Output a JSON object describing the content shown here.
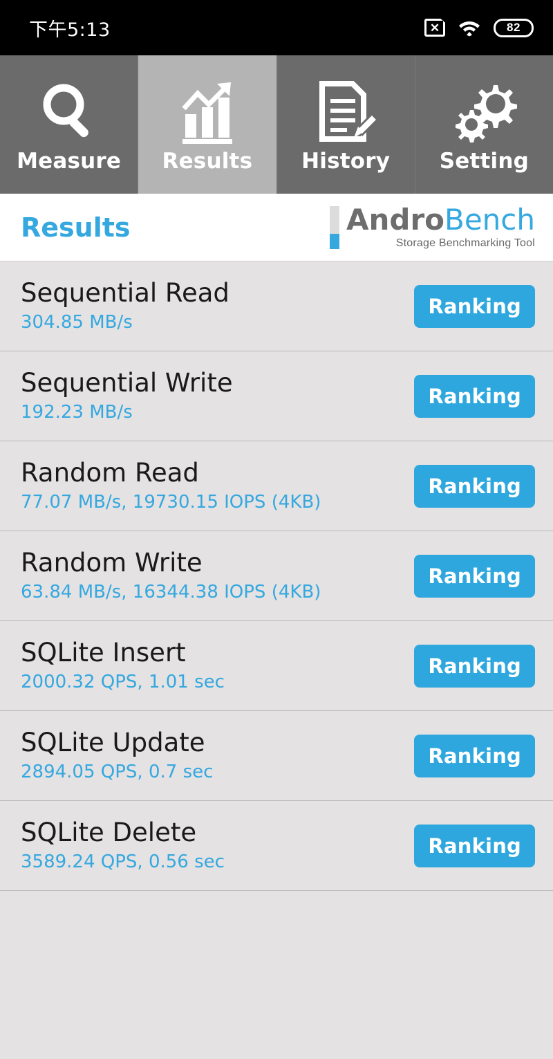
{
  "statusbar": {
    "time": "下午5:13",
    "nosim_icon": "no-sim-icon",
    "nosim_glyph": "✕",
    "wifi_icon": "wifi-icon",
    "battery_icon": "battery-icon",
    "battery_level": "82"
  },
  "tabs": [
    {
      "label": "Measure",
      "icon": "magnifier-icon",
      "active": false
    },
    {
      "label": "Results",
      "icon": "bar-chart-icon",
      "active": true
    },
    {
      "label": "History",
      "icon": "document-pen-icon",
      "active": false
    },
    {
      "label": "Setting",
      "icon": "gears-icon",
      "active": false
    }
  ],
  "header": {
    "title": "Results",
    "logo_andro": "Andro",
    "logo_bench": "Bench",
    "logo_subtitle": "Storage Benchmarking Tool"
  },
  "results": [
    {
      "name": "Sequential Read",
      "value": "304.85 MB/s",
      "button": "Ranking"
    },
    {
      "name": "Sequential Write",
      "value": "192.23 MB/s",
      "button": "Ranking"
    },
    {
      "name": "Random Read",
      "value": "77.07 MB/s, 19730.15 IOPS (4KB)",
      "button": "Ranking"
    },
    {
      "name": "Random Write",
      "value": "63.84 MB/s, 16344.38 IOPS (4KB)",
      "button": "Ranking"
    },
    {
      "name": "SQLite Insert",
      "value": "2000.32 QPS, 1.01 sec",
      "button": "Ranking"
    },
    {
      "name": "SQLite Update",
      "value": "2894.05 QPS, 0.7 sec",
      "button": "Ranking"
    },
    {
      "name": "SQLite Delete",
      "value": "3589.24 QPS, 0.56 sec",
      "button": "Ranking"
    }
  ],
  "colors": {
    "accent_blue": "#35a8e0",
    "button_blue": "#2ea7de",
    "tab_inactive": "#6b6b6b",
    "tab_active": "#b4b4b4",
    "row_bg": "#e4e2e2",
    "statusbar_bg": "#000000"
  }
}
